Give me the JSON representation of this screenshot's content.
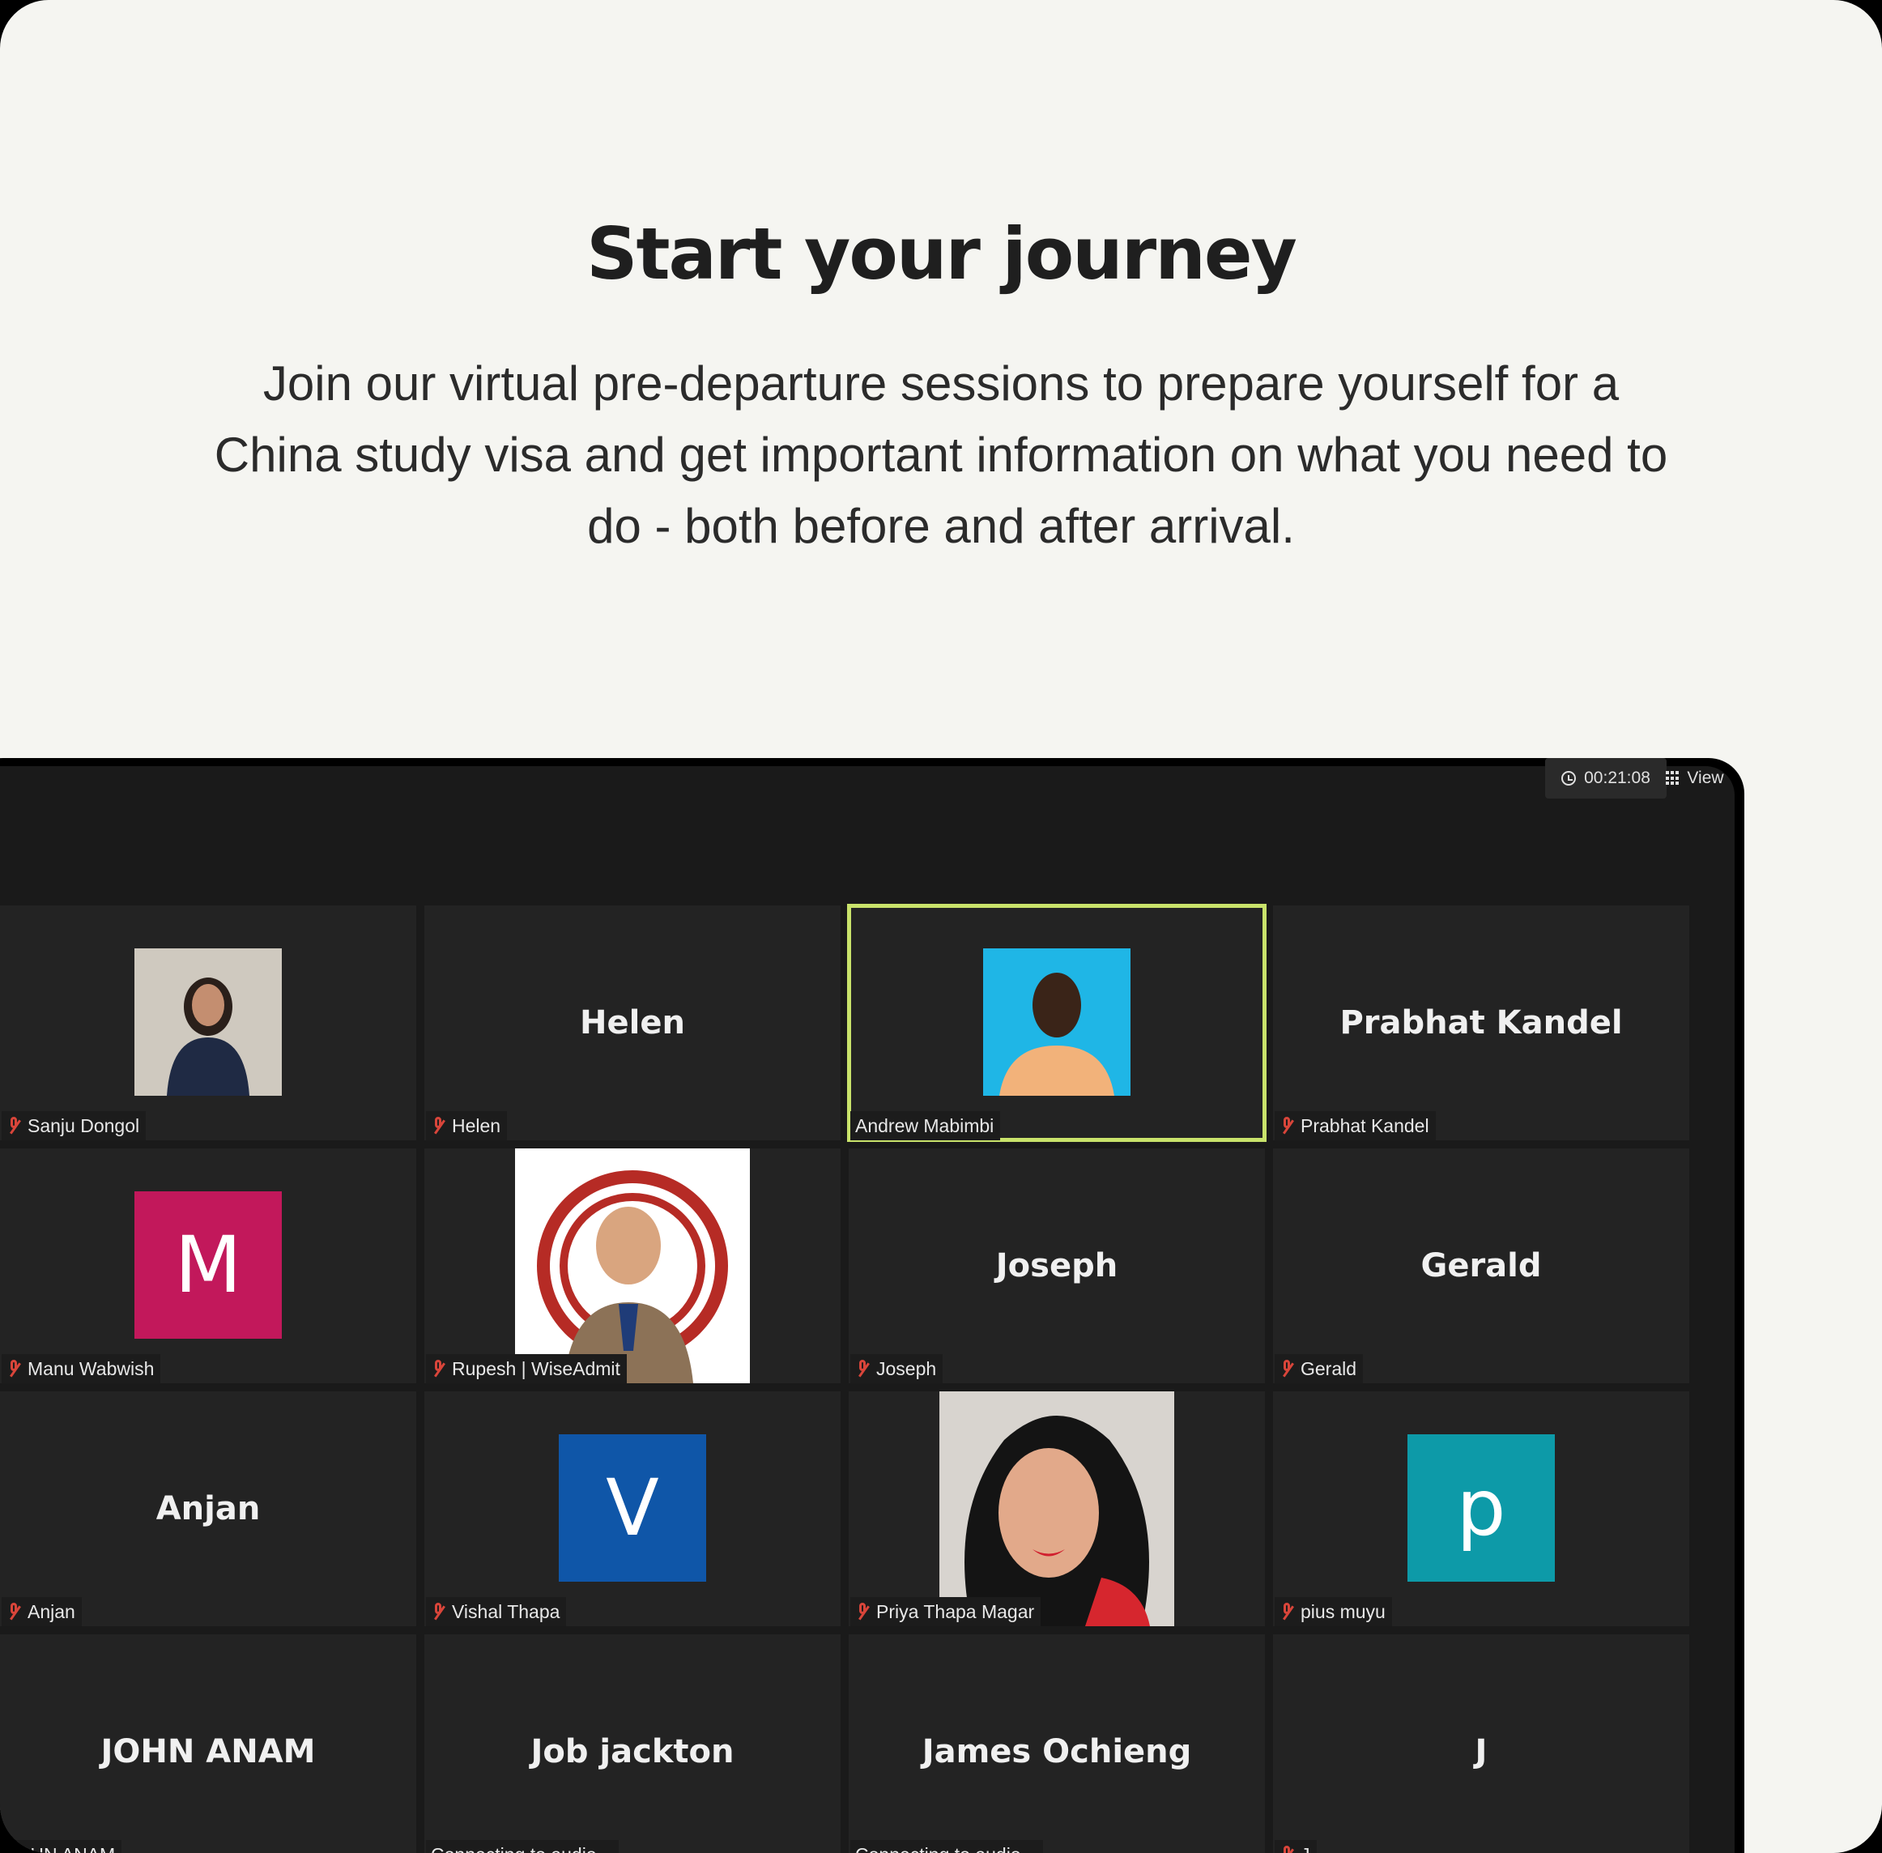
{
  "hero": {
    "title": "Start your journey",
    "description": "Join our virtual pre-departure sessions to prepare yourself for a China study visa and get important information on what you need to do - both before and after arrival."
  },
  "meeting": {
    "timer": "00:21:08",
    "view_label": "View",
    "participants": [
      {
        "display": "photo",
        "label": "Sanju Dongol",
        "muted": true
      },
      {
        "display": "Helen",
        "label": "Helen",
        "muted": true
      },
      {
        "display": "photo",
        "label": "Andrew Mabimbi",
        "muted": false,
        "active": true
      },
      {
        "display": "Prabhat Kandel",
        "label": "Prabhat Kandel",
        "muted": true
      },
      {
        "display": "M",
        "avatar_color": "#c2185b",
        "label": "Manu Wabwish",
        "muted": true
      },
      {
        "display": "photo",
        "label": "Rupesh | WiseAdmit",
        "muted": true
      },
      {
        "display": "Joseph",
        "label": "Joseph",
        "muted": true
      },
      {
        "display": "Gerald",
        "label": "Gerald",
        "muted": true
      },
      {
        "display": "Anjan",
        "label": "Anjan",
        "muted": true
      },
      {
        "display": "V",
        "avatar_color": "#0f56a8",
        "label": "Vishal Thapa",
        "muted": true
      },
      {
        "display": "photo",
        "label": "Priya Thapa Magar",
        "muted": true
      },
      {
        "display": "p",
        "avatar_color": "#0d9aa8",
        "label": "pius muyu",
        "muted": true
      },
      {
        "display": "JOHN ANAM",
        "label": "JOHN ANAM",
        "muted": false
      },
      {
        "display": "Job jackton",
        "label": "Connecting to audio...",
        "muted": false
      },
      {
        "display": "James Ochieng",
        "label": "Connecting to audio...",
        "muted": false
      },
      {
        "display": "J",
        "label": "J",
        "muted": true
      }
    ]
  }
}
